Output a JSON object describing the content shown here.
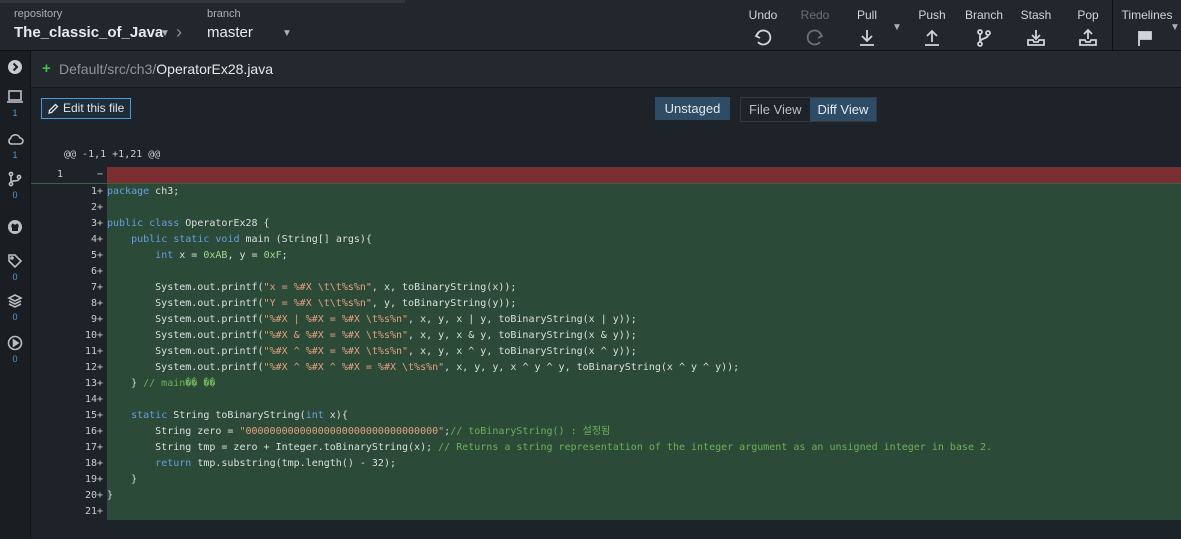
{
  "header": {
    "repository_label": "repository",
    "repository_name": "The_classic_of_Java",
    "branch_label": "branch",
    "branch_name": "master"
  },
  "toolbar": {
    "undo": "Undo",
    "redo": "Redo",
    "pull": "Pull",
    "push": "Push",
    "branch": "Branch",
    "stash": "Stash",
    "pop": "Pop",
    "timelines": "Timelines"
  },
  "sidebar": {
    "counts": [
      "1",
      "1",
      "0",
      "0",
      "0",
      "0"
    ]
  },
  "file": {
    "dir": "Default/src/ch3/",
    "name": "OperatorEx28.java"
  },
  "actions": {
    "edit": "Edit this file",
    "unstaged": "Unstaged",
    "file_view": "File View",
    "diff_view": "Diff View"
  },
  "diff": {
    "hunk": "@@ -1,1 +1,21 @@",
    "removed_line_number": "1",
    "lines": [
      "package ch3;",
      "",
      "public class OperatorEx28 {",
      "    public static void main (String[] args){",
      "        int x = 0xAB, y = 0xF;",
      "",
      "        System.out.printf(\"x = %#X \\t\\t%s%n\", x, toBinaryString(x));",
      "        System.out.printf(\"Y = %#X \\t\\t%s%n\", y, toBinaryString(y));",
      "        System.out.printf(\"%#X | %#X = %#X \\t%s%n\", x, y, x | y, toBinaryString(x | y));",
      "        System.out.printf(\"%#X & %#X = %#X \\t%s%n\", x, y, x & y, toBinaryString(x & y));",
      "        System.out.printf(\"%#X ^ %#X = %#X \\t%s%n\", x, y, x ^ y, toBinaryString(x ^ y));",
      "        System.out.printf(\"%#X ^ %#X ^ %#X = %#X \\t%s%n\", x, y, y, x ^ y ^ y, toBinaryString(x ^ y ^ y));",
      "    } // main�� ��",
      "",
      "    static String toBinaryString(int x){",
      "        String zero = \"00000000000000000000000000000000\";// toBinaryString() : 설정됨",
      "        String tmp = zero + Integer.toBinaryString(x); // Returns a string representation of the integer argument as an unsigned integer in base 2.",
      "        return tmp.substring(tmp.length() - 32);",
      "    }",
      "}",
      ""
    ]
  }
}
